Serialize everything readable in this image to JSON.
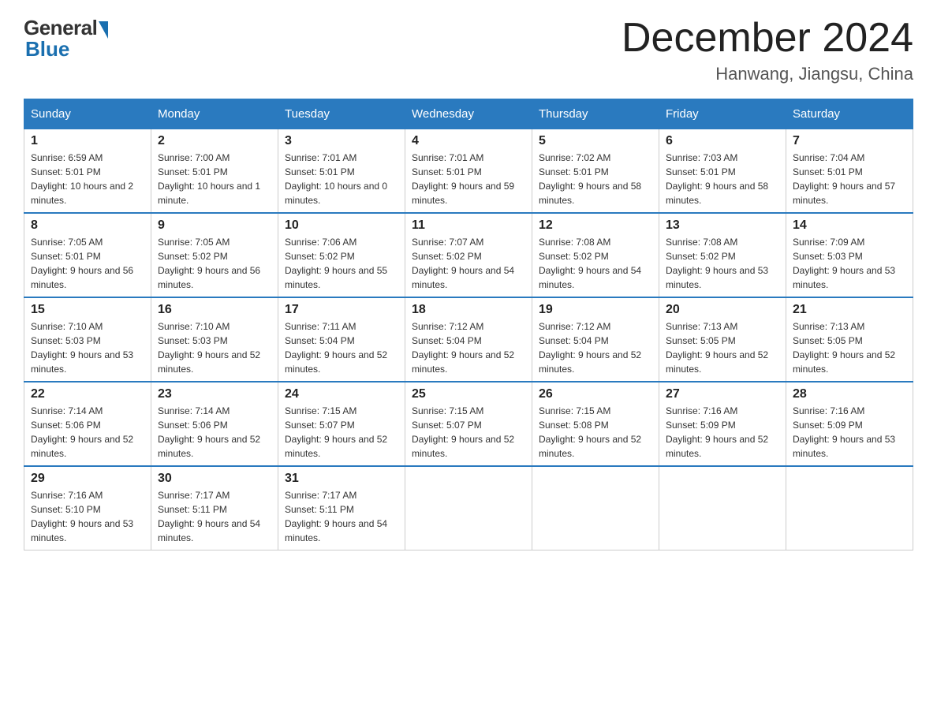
{
  "header": {
    "logo_general": "General",
    "logo_blue": "Blue",
    "month_title": "December 2024",
    "location": "Hanwang, Jiangsu, China"
  },
  "days_of_week": [
    "Sunday",
    "Monday",
    "Tuesday",
    "Wednesday",
    "Thursday",
    "Friday",
    "Saturday"
  ],
  "weeks": [
    [
      {
        "day": "1",
        "sunrise": "6:59 AM",
        "sunset": "5:01 PM",
        "daylight": "10 hours and 2 minutes."
      },
      {
        "day": "2",
        "sunrise": "7:00 AM",
        "sunset": "5:01 PM",
        "daylight": "10 hours and 1 minute."
      },
      {
        "day": "3",
        "sunrise": "7:01 AM",
        "sunset": "5:01 PM",
        "daylight": "10 hours and 0 minutes."
      },
      {
        "day": "4",
        "sunrise": "7:01 AM",
        "sunset": "5:01 PM",
        "daylight": "9 hours and 59 minutes."
      },
      {
        "day": "5",
        "sunrise": "7:02 AM",
        "sunset": "5:01 PM",
        "daylight": "9 hours and 58 minutes."
      },
      {
        "day": "6",
        "sunrise": "7:03 AM",
        "sunset": "5:01 PM",
        "daylight": "9 hours and 58 minutes."
      },
      {
        "day": "7",
        "sunrise": "7:04 AM",
        "sunset": "5:01 PM",
        "daylight": "9 hours and 57 minutes."
      }
    ],
    [
      {
        "day": "8",
        "sunrise": "7:05 AM",
        "sunset": "5:01 PM",
        "daylight": "9 hours and 56 minutes."
      },
      {
        "day": "9",
        "sunrise": "7:05 AM",
        "sunset": "5:02 PM",
        "daylight": "9 hours and 56 minutes."
      },
      {
        "day": "10",
        "sunrise": "7:06 AM",
        "sunset": "5:02 PM",
        "daylight": "9 hours and 55 minutes."
      },
      {
        "day": "11",
        "sunrise": "7:07 AM",
        "sunset": "5:02 PM",
        "daylight": "9 hours and 54 minutes."
      },
      {
        "day": "12",
        "sunrise": "7:08 AM",
        "sunset": "5:02 PM",
        "daylight": "9 hours and 54 minutes."
      },
      {
        "day": "13",
        "sunrise": "7:08 AM",
        "sunset": "5:02 PM",
        "daylight": "9 hours and 53 minutes."
      },
      {
        "day": "14",
        "sunrise": "7:09 AM",
        "sunset": "5:03 PM",
        "daylight": "9 hours and 53 minutes."
      }
    ],
    [
      {
        "day": "15",
        "sunrise": "7:10 AM",
        "sunset": "5:03 PM",
        "daylight": "9 hours and 53 minutes."
      },
      {
        "day": "16",
        "sunrise": "7:10 AM",
        "sunset": "5:03 PM",
        "daylight": "9 hours and 52 minutes."
      },
      {
        "day": "17",
        "sunrise": "7:11 AM",
        "sunset": "5:04 PM",
        "daylight": "9 hours and 52 minutes."
      },
      {
        "day": "18",
        "sunrise": "7:12 AM",
        "sunset": "5:04 PM",
        "daylight": "9 hours and 52 minutes."
      },
      {
        "day": "19",
        "sunrise": "7:12 AM",
        "sunset": "5:04 PM",
        "daylight": "9 hours and 52 minutes."
      },
      {
        "day": "20",
        "sunrise": "7:13 AM",
        "sunset": "5:05 PM",
        "daylight": "9 hours and 52 minutes."
      },
      {
        "day": "21",
        "sunrise": "7:13 AM",
        "sunset": "5:05 PM",
        "daylight": "9 hours and 52 minutes."
      }
    ],
    [
      {
        "day": "22",
        "sunrise": "7:14 AM",
        "sunset": "5:06 PM",
        "daylight": "9 hours and 52 minutes."
      },
      {
        "day": "23",
        "sunrise": "7:14 AM",
        "sunset": "5:06 PM",
        "daylight": "9 hours and 52 minutes."
      },
      {
        "day": "24",
        "sunrise": "7:15 AM",
        "sunset": "5:07 PM",
        "daylight": "9 hours and 52 minutes."
      },
      {
        "day": "25",
        "sunrise": "7:15 AM",
        "sunset": "5:07 PM",
        "daylight": "9 hours and 52 minutes."
      },
      {
        "day": "26",
        "sunrise": "7:15 AM",
        "sunset": "5:08 PM",
        "daylight": "9 hours and 52 minutes."
      },
      {
        "day": "27",
        "sunrise": "7:16 AM",
        "sunset": "5:09 PM",
        "daylight": "9 hours and 52 minutes."
      },
      {
        "day": "28",
        "sunrise": "7:16 AM",
        "sunset": "5:09 PM",
        "daylight": "9 hours and 53 minutes."
      }
    ],
    [
      {
        "day": "29",
        "sunrise": "7:16 AM",
        "sunset": "5:10 PM",
        "daylight": "9 hours and 53 minutes."
      },
      {
        "day": "30",
        "sunrise": "7:17 AM",
        "sunset": "5:11 PM",
        "daylight": "9 hours and 54 minutes."
      },
      {
        "day": "31",
        "sunrise": "7:17 AM",
        "sunset": "5:11 PM",
        "daylight": "9 hours and 54 minutes."
      },
      null,
      null,
      null,
      null
    ]
  ]
}
